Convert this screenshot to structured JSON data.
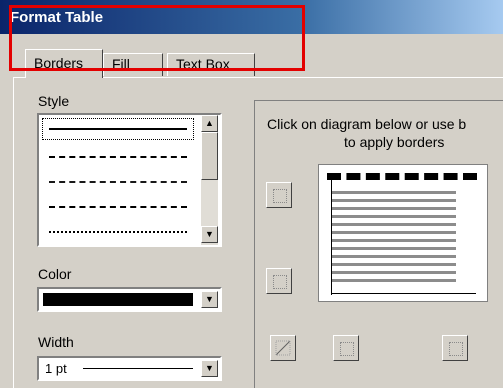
{
  "window": {
    "title": "Format Table"
  },
  "tabs": [
    {
      "label": "Borders",
      "active": true
    },
    {
      "label": "Fill",
      "active": false
    },
    {
      "label": "Text Box",
      "active": false
    }
  ],
  "style_section": {
    "label": "Style"
  },
  "color_section": {
    "label": "Color",
    "value_color": "#000000"
  },
  "width_section": {
    "label": "Width",
    "value": "1 pt"
  },
  "diagram_section": {
    "instruction_line1": "Click on diagram below or use b",
    "instruction_line2": "to apply borders"
  },
  "scroll_icons": {
    "up": "▲",
    "down": "▼"
  },
  "accent_colors": {
    "title_bar": "#0a246a",
    "highlight_box": "#e30000",
    "face": "#d4d0c8"
  }
}
